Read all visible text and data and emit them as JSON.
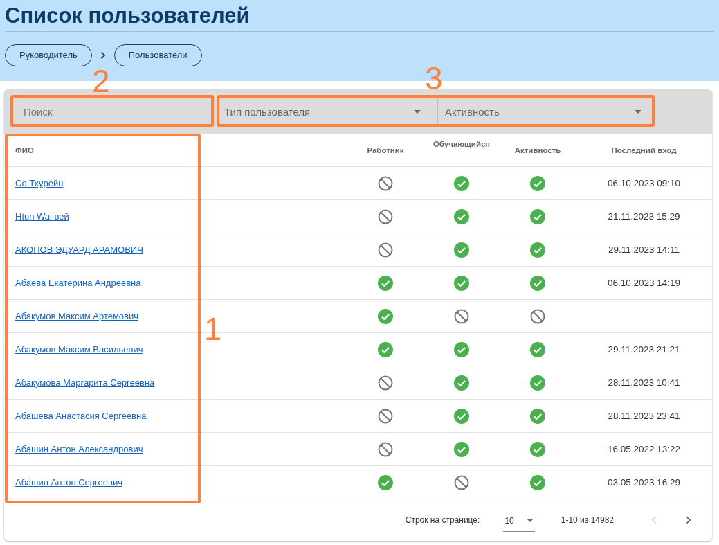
{
  "page_title": "Список пользователей",
  "breadcrumbs": [
    {
      "label": "Руководитель"
    },
    {
      "label": "Пользователи"
    }
  ],
  "filters": {
    "search": {
      "placeholder": "Поиск"
    },
    "selects": [
      {
        "placeholder": "Тип пользователя"
      },
      {
        "placeholder": "Активность"
      }
    ]
  },
  "table": {
    "columns": [
      "ФИО",
      "Работник",
      "Обучающийся",
      "Активность",
      "Последний вход"
    ],
    "rows": [
      {
        "name": "Со Тхурейн",
        "worker": false,
        "student": true,
        "active": true,
        "last_login": "06.10.2023 09:10"
      },
      {
        "name": "Htun Wai вей",
        "worker": false,
        "student": true,
        "active": true,
        "last_login": "21.11.2023 15:29"
      },
      {
        "name": "АКОПОВ ЭДУАРД АРАМОВИЧ",
        "worker": false,
        "student": true,
        "active": true,
        "last_login": "29.11.2023 14:11"
      },
      {
        "name": "Абаева Екатерина Андреевна",
        "worker": true,
        "student": true,
        "active": true,
        "last_login": "06.10.2023 14:19"
      },
      {
        "name": "Абакумов Максим Артемович",
        "worker": true,
        "student": false,
        "active": false
      },
      {
        "name": "Абакумов Максим Васильевич",
        "worker": true,
        "student": true,
        "active": true,
        "last_login": "29.11.2023 21:21"
      },
      {
        "name": "Абакумова Маргарита Сергеевна",
        "worker": false,
        "student": true,
        "active": true,
        "last_login": "28.11.2023 10:41"
      },
      {
        "name": "Абашева Анастасия Сергеевна",
        "worker": false,
        "student": true,
        "active": true,
        "last_login": "28.11.2023 23:41"
      },
      {
        "name": "Абашин Антон Александрович",
        "worker": false,
        "student": true,
        "active": true,
        "last_login": "16.05.2022 13:22"
      },
      {
        "name": "Абашин Антон Сергеевич",
        "worker": true,
        "student": false,
        "active": true,
        "last_login": "03.05.2023 16:29"
      }
    ]
  },
  "pagination": {
    "rows_label": "Строк на странице:",
    "rows_per_page": "10",
    "range": "1-10 из 14982",
    "prev_disabled": true,
    "next_disabled": false
  },
  "annotations": [
    {
      "label": "1"
    },
    {
      "label": "2"
    },
    {
      "label": "3"
    }
  ]
}
